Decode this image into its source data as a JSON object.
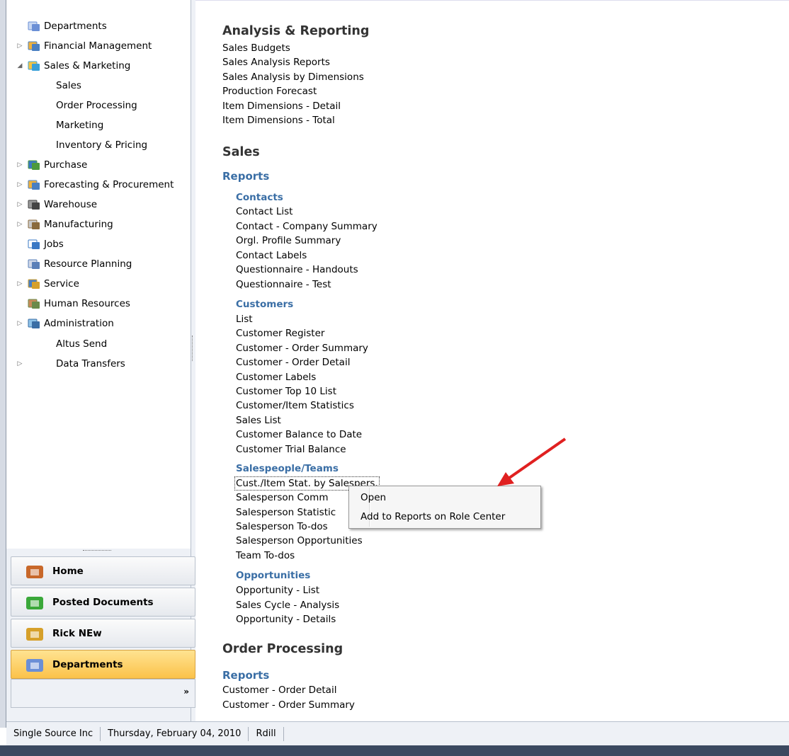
{
  "nav": {
    "items": [
      {
        "label": "Departments",
        "expander": "",
        "icon": "departments-icon",
        "indent": false
      },
      {
        "label": "Financial Management",
        "expander": "▷",
        "icon": "financial-icon",
        "indent": false
      },
      {
        "label": "Sales & Marketing",
        "expander": "◢",
        "icon": "sales-marketing-icon",
        "indent": false
      },
      {
        "label": "Sales",
        "expander": "",
        "icon": "",
        "indent": true
      },
      {
        "label": "Order Processing",
        "expander": "",
        "icon": "",
        "indent": true
      },
      {
        "label": "Marketing",
        "expander": "",
        "icon": "",
        "indent": true
      },
      {
        "label": "Inventory & Pricing",
        "expander": "",
        "icon": "",
        "indent": true
      },
      {
        "label": "Purchase",
        "expander": "▷",
        "icon": "purchase-icon",
        "indent": false
      },
      {
        "label": "Forecasting & Procurement",
        "expander": "▷",
        "icon": "forecasting-icon",
        "indent": false
      },
      {
        "label": "Warehouse",
        "expander": "▷",
        "icon": "warehouse-icon",
        "indent": false
      },
      {
        "label": "Manufacturing",
        "expander": "▷",
        "icon": "manufacturing-icon",
        "indent": false
      },
      {
        "label": "Jobs",
        "expander": "",
        "icon": "jobs-icon",
        "indent": false
      },
      {
        "label": "Resource Planning",
        "expander": "",
        "icon": "resource-planning-icon",
        "indent": false
      },
      {
        "label": "Service",
        "expander": "▷",
        "icon": "service-icon",
        "indent": false
      },
      {
        "label": "Human Resources",
        "expander": "",
        "icon": "human-resources-icon",
        "indent": false
      },
      {
        "label": "Administration",
        "expander": "▷",
        "icon": "administration-icon",
        "indent": false
      },
      {
        "label": "Altus Send",
        "expander": "",
        "icon": "",
        "indent": true
      },
      {
        "label": "Data Transfers",
        "expander": "▷",
        "icon": "",
        "indent": true
      }
    ]
  },
  "wunderbar": {
    "buttons": [
      {
        "label": "Home",
        "icon": "home-icon"
      },
      {
        "label": "Posted Documents",
        "icon": "posted-documents-icon"
      },
      {
        "label": "Rick NEw",
        "icon": "rick-new-icon"
      },
      {
        "label": "Departments",
        "icon": "departments-icon"
      }
    ],
    "more": "»"
  },
  "main": {
    "analysis_title": "Analysis & Reporting",
    "analysis_links": [
      "Sales Budgets",
      "Sales Analysis Reports",
      "Sales Analysis by Dimensions",
      "Production Forecast",
      "Item Dimensions - Detail",
      "Item Dimensions - Total"
    ],
    "sales_title": "Sales",
    "reports_title": "Reports",
    "contacts_title": "Contacts",
    "contacts_links": [
      "Contact List",
      "Contact - Company Summary",
      "Orgl. Profile Summary",
      "Contact Labels",
      "Questionnaire - Handouts",
      "Questionnaire - Test"
    ],
    "customers_title": "Customers",
    "customers_links": [
      "List",
      "Customer Register",
      "Customer - Order Summary",
      "Customer - Order Detail",
      "Customer Labels",
      "Customer Top 10 List",
      "Customer/Item Statistics",
      "Sales List",
      "Customer Balance to Date",
      "Customer Trial Balance"
    ],
    "salespeople_title": "Salespeople/Teams",
    "salespeople_links": [
      "Cust./Item Stat. by Salespers.",
      "Salesperson Comm",
      "Salesperson Statistic",
      "Salesperson To-dos",
      "Salesperson Opportunities",
      "Team To-dos"
    ],
    "opportunities_title": "Opportunities",
    "opportunities_links": [
      "Opportunity - List",
      "Sales Cycle - Analysis",
      "Opportunity - Details"
    ],
    "order_title": "Order Processing",
    "order_reports_title": "Reports",
    "order_links": [
      "Customer - Order Detail",
      "Customer - Order Summary"
    ]
  },
  "context_menu": {
    "open": "Open",
    "add": "Add to Reports on Role Center"
  },
  "status": {
    "company": "Single Source Inc",
    "date": "Thursday, February 04, 2010",
    "user": "Rdill"
  },
  "colors": {
    "accent": "#3a6ea5",
    "arrow": "#e02020",
    "active_button": "#fbc24a"
  }
}
